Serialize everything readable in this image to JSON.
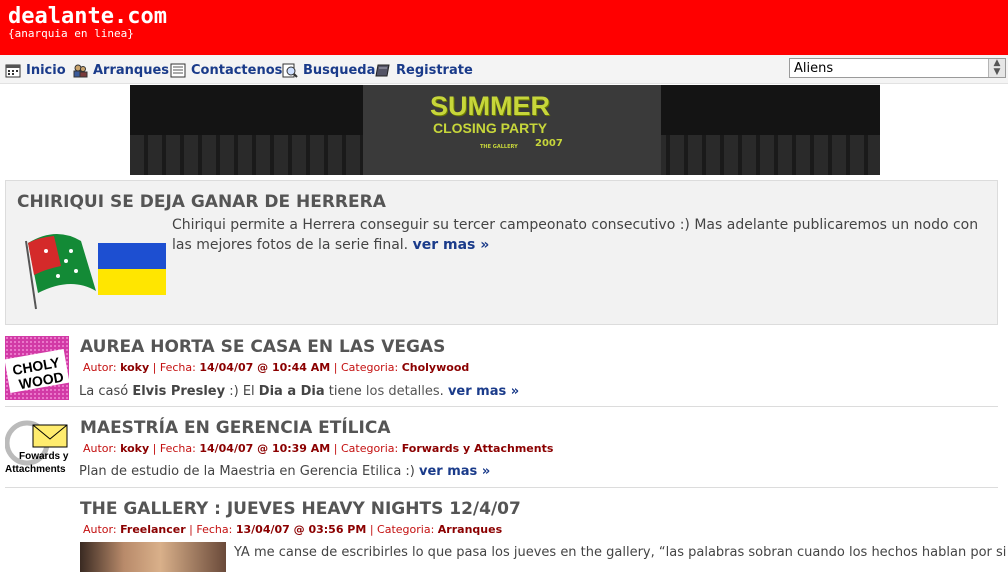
{
  "header": {
    "logo": "dealante.com",
    "slogan": "{anarquia en linea}"
  },
  "nav": {
    "items": [
      {
        "label": "Inicio",
        "icon": "calendar-icon"
      },
      {
        "label": "Arranques",
        "icon": "users-icon"
      },
      {
        "label": "Contactenos",
        "icon": "card-icon"
      },
      {
        "label": "Busqueda",
        "icon": "search-icon"
      },
      {
        "label": "Registrate",
        "icon": "book-icon"
      }
    ],
    "theme_select": "Aliens"
  },
  "banner": {
    "line1": "SUMMER",
    "line2": "CLOSING PARTY",
    "year": "2007",
    "venue": "THE GALLERY"
  },
  "featured": {
    "title": "CHIRIQUI SE DEJA GANAR DE HERRERA",
    "text": "Chiriqui permite a Herrera conseguir su tercer campeonato consecutivo :) Mas adelante publicaremos un nodo con las mejores fotos de la serie final.",
    "more": "ver mas »"
  },
  "articles": [
    {
      "title": "AUREA HORTA SE CASA EN LAS VEGAS",
      "autor_label": "Autor:",
      "autor": "koky",
      "fecha_label": "Fecha:",
      "fecha": "14/04/07 @ 10:44 AM",
      "cat_label": "Categoria:",
      "categoria": "Cholywood",
      "body": {
        "p1": "La casó ",
        "b1": "Elvis Presley",
        "p2": " :) El ",
        "b2": "Dia a Dia",
        "p3": " tiene ",
        "link": "los detalles",
        "p4": ".",
        "more": "ver mas »"
      },
      "thumb": {
        "l1": "CHOLY",
        "l2": "WOOD"
      }
    },
    {
      "title": "MAESTRÍA EN GERENCIA ETÍLICA",
      "autor_label": "Autor:",
      "autor": "koky",
      "fecha_label": "Fecha:",
      "fecha": "14/04/07 @ 10:39 AM",
      "cat_label": "Categoria:",
      "categoria": "Forwards y Attachments",
      "body": {
        "text": "Plan de estudio de la Maestria en Gerencia Etilica :)",
        "more": "ver mas »"
      },
      "thumb": {
        "l1": "Fowards y",
        "l2": "Attachments"
      }
    },
    {
      "title": "THE GALLERY : JUEVES HEAVY NIGHTS 12/4/07",
      "autor_label": "Autor:",
      "autor": "Freelancer",
      "fecha_label": "Fecha:",
      "fecha": "13/04/07 @ 03:56 PM",
      "cat_label": "Categoria:",
      "categoria": "Arranques",
      "body": {
        "text": "YA me canse de escribirles lo que pasa los jueves en the gallery, “las palabras sobran cuando los hechos hablan por si"
      }
    }
  ],
  "colors": {
    "brand": "#ff0000",
    "link": "#1a3b8a",
    "meta": "#c41010"
  }
}
